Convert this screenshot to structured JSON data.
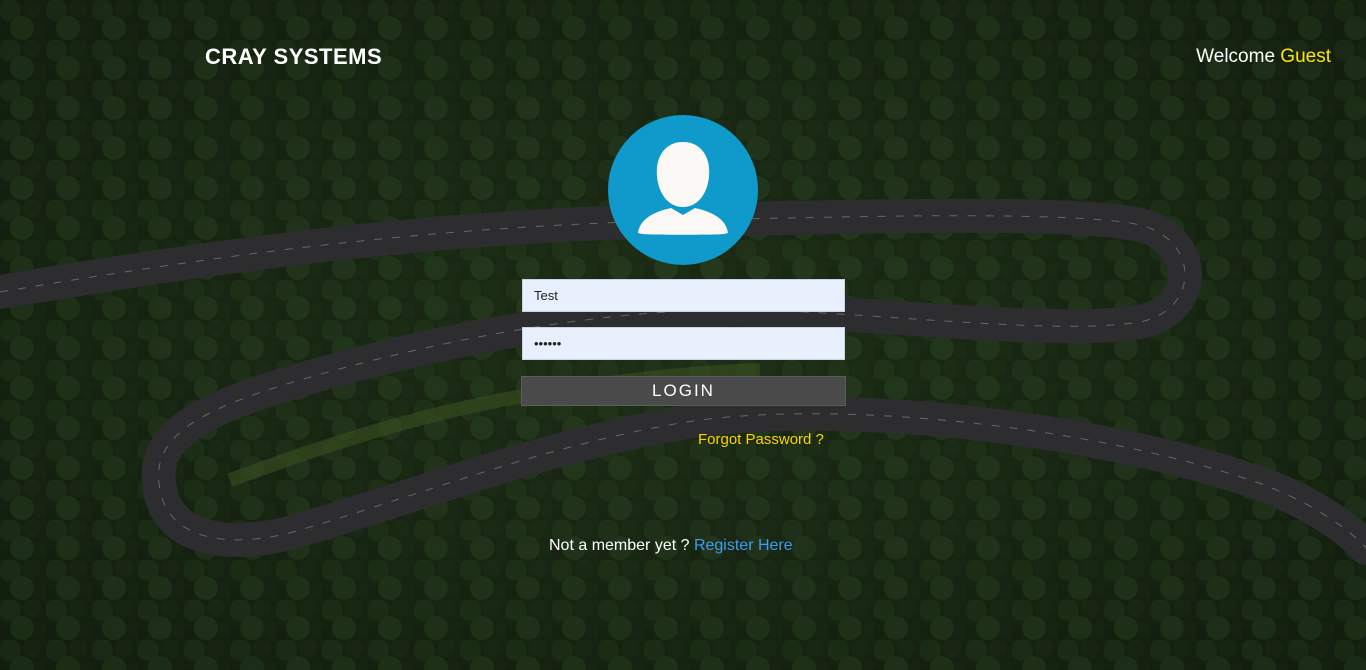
{
  "header": {
    "brand": "CRAY SYSTEMS",
    "welcome_text": "Welcome",
    "user_name": "Guest"
  },
  "avatar": {
    "icon": "user-silhouette-icon",
    "color": "#0f9acb"
  },
  "login_form": {
    "username_value": "Test",
    "password_value": "abcdef",
    "login_label": "LOGIN",
    "forgot_label": "Forgot Password ?"
  },
  "footer": {
    "prompt": "Not a member yet ?",
    "register_label": "Register Here"
  },
  "colors": {
    "accent_yellow": "#ffe600",
    "link_yellow": "#ffd200",
    "link_blue": "#3d9df0",
    "button_bg": "#4a4a4a",
    "input_bg": "#e8f0fe"
  }
}
